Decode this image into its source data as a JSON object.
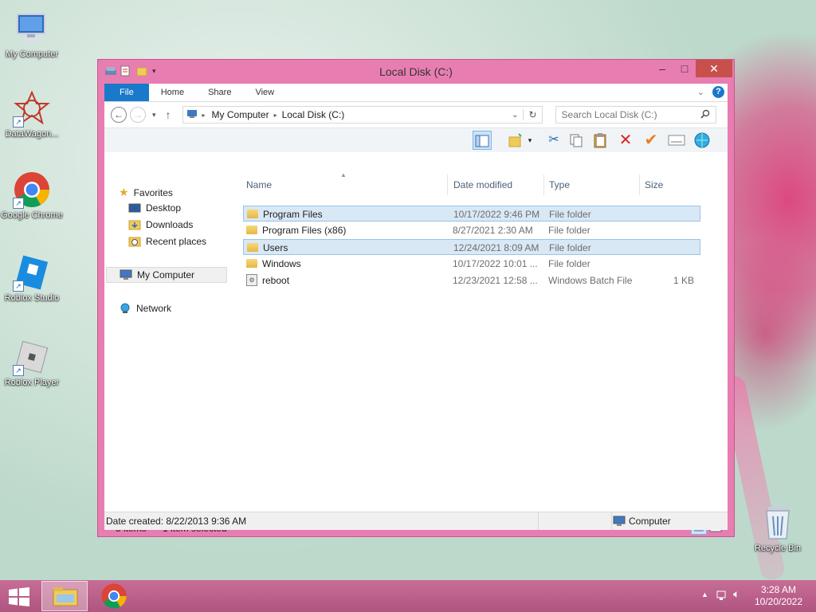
{
  "desktop": {
    "icons": [
      {
        "label": "My Computer"
      },
      {
        "label": "DataWagon..."
      },
      {
        "label": "Google Chrome"
      },
      {
        "label": "Roblox Studio"
      },
      {
        "label": "Roblox Player"
      },
      {
        "label": "Recycle Bin"
      }
    ]
  },
  "window": {
    "title": "Local Disk (C:)",
    "ribbon_tabs": [
      "File",
      "Home",
      "Share",
      "View"
    ],
    "help": "?",
    "breadcrumb": [
      "My Computer",
      "Local Disk (C:)"
    ],
    "search_placeholder": "Search Local Disk (C:)",
    "nav": {
      "favorites": "Favorites",
      "desktop": "Desktop",
      "downloads": "Downloads",
      "recent": "Recent places",
      "computer": "My Computer",
      "network": "Network"
    },
    "columns": [
      "Name",
      "Date modified",
      "Type",
      "Size"
    ],
    "files": [
      {
        "name": "Program Files",
        "date": "10/17/2022 9:46 PM",
        "type": "File folder",
        "size": "",
        "icon": "folder-icon",
        "highlight": true
      },
      {
        "name": "Program Files (x86)",
        "date": "8/27/2021 2:30 AM",
        "type": "File folder",
        "size": "",
        "icon": "folder-icon",
        "highlight": false
      },
      {
        "name": "Users",
        "date": "12/24/2021 8:09 AM",
        "type": "File folder",
        "size": "",
        "icon": "folder-icon",
        "highlight": true
      },
      {
        "name": "Windows",
        "date": "10/17/2022 10:01 ...",
        "type": "File folder",
        "size": "",
        "icon": "folder-icon",
        "highlight": false
      },
      {
        "name": "reboot",
        "date": "12/23/2021 12:58 ...",
        "type": "Windows Batch File",
        "size": "1 KB",
        "icon": "batch-file-icon",
        "highlight": false
      }
    ],
    "status": {
      "items": "5 items",
      "selected": "1 item selected",
      "date_created": "Date created: 8/22/2013 9:36 AM",
      "location": "Computer"
    }
  },
  "taskbar": {
    "time": "3:28 AM",
    "date": "10/20/2022"
  }
}
